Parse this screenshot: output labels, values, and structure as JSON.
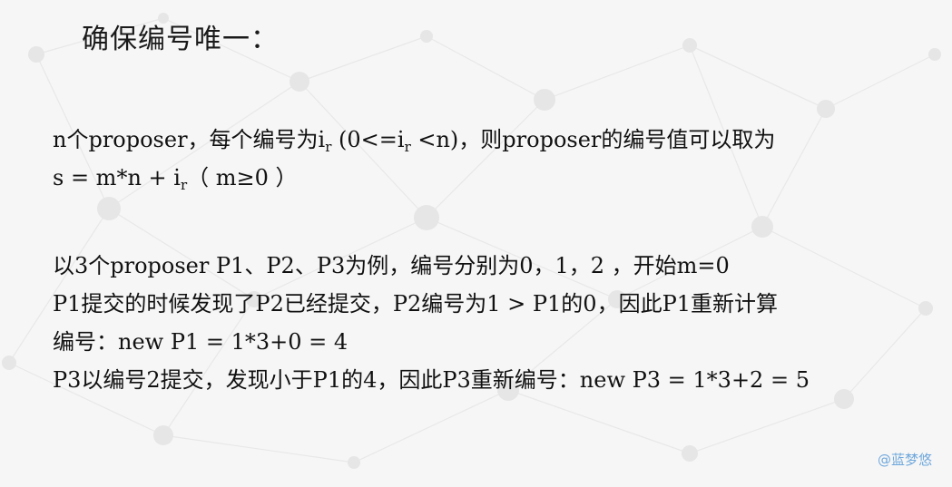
{
  "title": "确保编号唯一：",
  "para1": {
    "line1": {
      "pre": "n个proposer，每个编号为i",
      "sub1": "r",
      "mid": " (0<=i",
      "sub2": "r",
      "post": " <n)，则proposer的编号值可以取为"
    },
    "line2": {
      "pre": "s = m*n + i",
      "sub": "r",
      "post": "（ m≥0 ）"
    }
  },
  "para2": {
    "lines": [
      "以3个proposer P1、P2、P3为例，编号分别为0，1，2 ，开始m=0",
      "P1提交的时候发现了P2已经提交，P2编号为1 > P1的0，因此P1重新计算",
      "编号：new P1 = 1*3+0 = 4",
      "P3以编号2提交，发现小于P1的4，因此P3重新编号：new P3 = 1*3+2 = 5"
    ]
  },
  "watermark": "@蓝梦悠"
}
